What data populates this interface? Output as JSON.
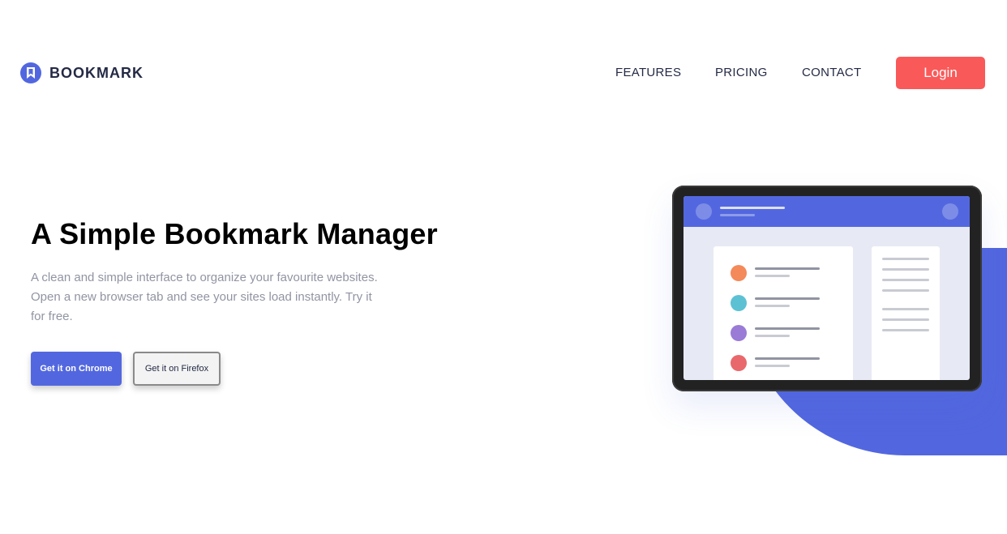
{
  "brand": {
    "name": "BOOKMARK",
    "logo_icon": "bookmark-icon",
    "accent": "#5267DF"
  },
  "nav": {
    "items": [
      {
        "label": "FEATURES"
      },
      {
        "label": "PRICING"
      },
      {
        "label": "CONTACT"
      }
    ],
    "login_label": "Login",
    "login_color": "#FA5959"
  },
  "hero": {
    "title": "A Simple Bookmark Manager",
    "description": "A clean and simple interface to organize your favourite websites. Open a new browser tab and see your sites load instantly. Try it for free.",
    "chrome_label": "Get it on Chrome",
    "firefox_label": "Get it on Firefox"
  },
  "illustration": {
    "list_dot_colors": [
      "#F4895A",
      "#5DC1D4",
      "#9A7BD6",
      "#E8686C"
    ]
  }
}
